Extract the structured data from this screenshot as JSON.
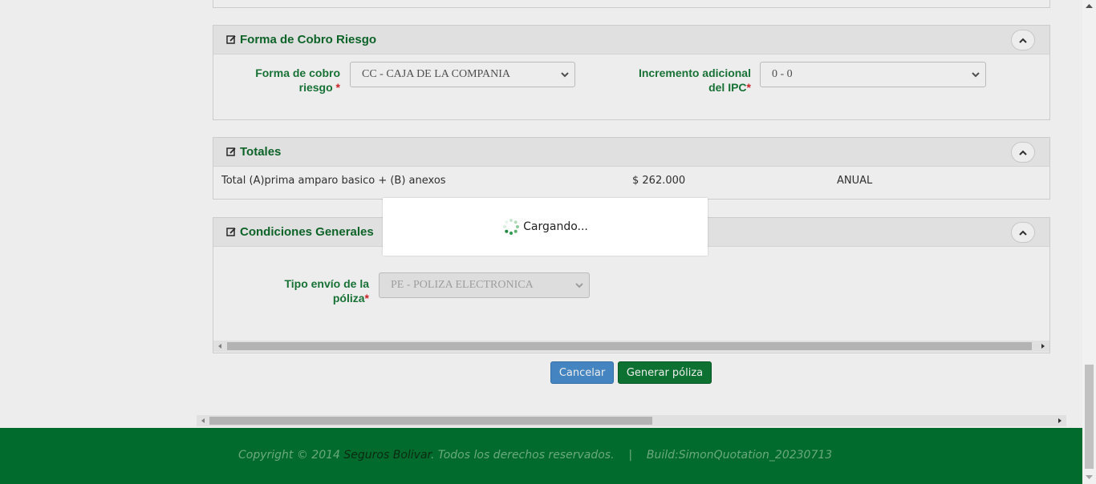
{
  "panels": {
    "forma_cobro": {
      "title": "Forma de Cobro Riesgo",
      "field1_label_1": "Forma de cobro",
      "field1_label_2": "riesgo",
      "field1_value": "CC - CAJA DE LA COMPANIA",
      "field2_label_1": "Incremento adicional",
      "field2_label_2": "del IPC",
      "field2_value": "0 - 0",
      "required_mark": "*"
    },
    "totales": {
      "title": "Totales",
      "row_label": "Total (A)prima amparo basico + (B) anexos",
      "row_amount": "$ 262.000",
      "row_period": "ANUAL"
    },
    "condiciones": {
      "title": "Condiciones Generales",
      "field_label_1": "Tipo envío de la",
      "field_label_2": "póliza",
      "field_value": "PE - POLIZA ELECTRONICA",
      "required_mark": "*"
    }
  },
  "buttons": {
    "cancel": "Cancelar",
    "generate": "Generar póliza"
  },
  "loading": {
    "text": "Cargando..."
  },
  "footer": {
    "prefix": "Copyright © 2014 ",
    "brand": "Seguros Bolivar",
    "suffix": ". Todos los derechos reservados.",
    "separator": "|",
    "build": "Build:SimonQuotation_20230713"
  },
  "colors": {
    "accent_green": "#0d7a35",
    "footer_green": "#006b2c",
    "cancel_blue": "#4a90d0"
  }
}
